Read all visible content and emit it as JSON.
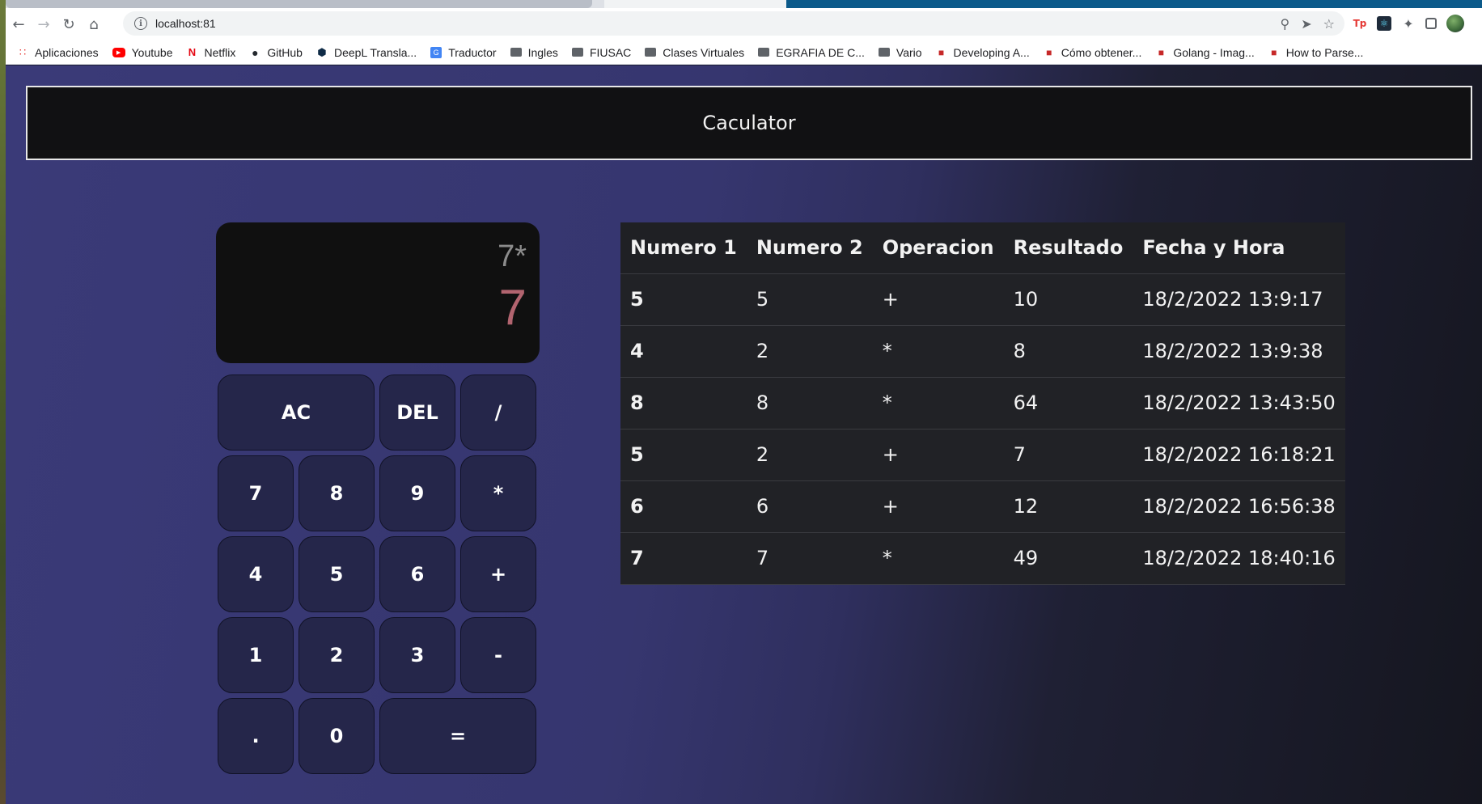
{
  "browser": {
    "url": "localhost:81",
    "bookmarks": [
      {
        "label": "Aplicaciones",
        "icon": "apps-grid-icon"
      },
      {
        "label": "Youtube",
        "icon": "youtube-icon"
      },
      {
        "label": "Netflix",
        "icon": "netflix-icon"
      },
      {
        "label": "GitHub",
        "icon": "github-icon"
      },
      {
        "label": "DeepL Transla...",
        "icon": "deepl-icon"
      },
      {
        "label": "Traductor",
        "icon": "translate-icon"
      },
      {
        "label": "Ingles",
        "icon": "folder-icon"
      },
      {
        "label": "FIUSAC",
        "icon": "folder-icon"
      },
      {
        "label": "Clases Virtuales",
        "icon": "folder-icon"
      },
      {
        "label": "EGRAFIA DE C...",
        "icon": "folder-icon"
      },
      {
        "label": "Vario",
        "icon": "folder-icon"
      },
      {
        "label": "Developing A...",
        "icon": "site-icon"
      },
      {
        "label": "Cómo obtener...",
        "icon": "site-icon"
      },
      {
        "label": "Golang - Imag...",
        "icon": "site-icon"
      },
      {
        "label": "How to Parse...",
        "icon": "site-icon"
      }
    ]
  },
  "page": {
    "title": "Caculator"
  },
  "calculator": {
    "previous_operand": "7*",
    "current_operand": "7",
    "keys": {
      "ac": "AC",
      "del": "DEL",
      "divide": "/",
      "seven": "7",
      "eight": "8",
      "nine": "9",
      "multiply": "*",
      "four": "4",
      "five": "5",
      "six": "6",
      "plus": "+",
      "one": "1",
      "two": "2",
      "three": "3",
      "minus": "-",
      "dot": ".",
      "zero": "0",
      "equals": "="
    }
  },
  "history": {
    "headers": {
      "num1": "Numero 1",
      "num2": "Numero 2",
      "op": "Operacion",
      "result": "Resultado",
      "datetime": "Fecha y Hora"
    },
    "rows": [
      {
        "num1": "5",
        "num2": "5",
        "op": "+",
        "result": "10",
        "datetime": "18/2/2022 13:9:17"
      },
      {
        "num1": "4",
        "num2": "2",
        "op": "*",
        "result": "8",
        "datetime": "18/2/2022 13:9:38"
      },
      {
        "num1": "8",
        "num2": "8",
        "op": "*",
        "result": "64",
        "datetime": "18/2/2022 13:43:50"
      },
      {
        "num1": "5",
        "num2": "2",
        "op": "+",
        "result": "7",
        "datetime": "18/2/2022 16:18:21"
      },
      {
        "num1": "6",
        "num2": "6",
        "op": "+",
        "result": "12",
        "datetime": "18/2/2022 16:56:38"
      },
      {
        "num1": "7",
        "num2": "7",
        "op": "*",
        "result": "49",
        "datetime": "18/2/2022 18:40:16"
      }
    ]
  }
}
